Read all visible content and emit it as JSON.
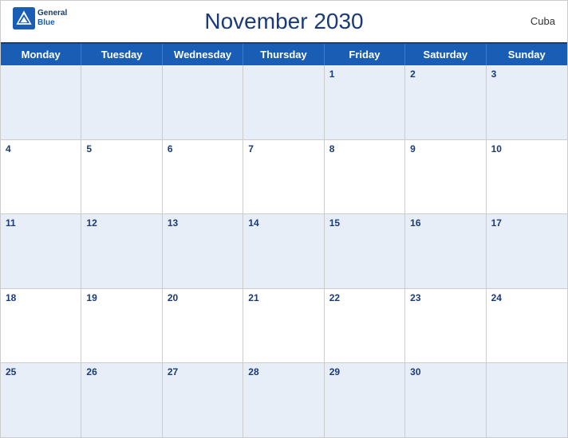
{
  "header": {
    "title": "November 2030",
    "country": "Cuba",
    "logo": {
      "general": "General",
      "blue": "Blue"
    }
  },
  "weekdays": [
    "Monday",
    "Tuesday",
    "Wednesday",
    "Thursday",
    "Friday",
    "Saturday",
    "Sunday"
  ],
  "weeks": [
    [
      null,
      null,
      null,
      null,
      1,
      2,
      3
    ],
    [
      4,
      5,
      6,
      7,
      8,
      9,
      10
    ],
    [
      11,
      12,
      13,
      14,
      15,
      16,
      17
    ],
    [
      18,
      19,
      20,
      21,
      22,
      23,
      24
    ],
    [
      25,
      26,
      27,
      28,
      29,
      30,
      null
    ]
  ]
}
